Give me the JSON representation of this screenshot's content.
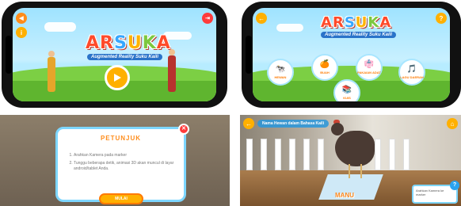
{
  "screen1": {
    "logo": {
      "a": "A",
      "r": "R",
      "s": "S",
      "u": "U",
      "k": "K",
      "a2": "A"
    },
    "tagline": "Augmented Reality Suku Kaili",
    "play_icon": "play-icon",
    "sound_icon": "speaker-icon",
    "info_icon": "info-icon",
    "exit_icon": "exit-icon"
  },
  "screen2": {
    "logo": {
      "a": "A",
      "r": "R",
      "s": "S",
      "u": "U",
      "k": "K",
      "a2": "A"
    },
    "tagline": "Augmented Reality Suku Kaili",
    "back_icon": "back-arrow-icon",
    "help_label": "?",
    "menu": [
      {
        "label": "HEWAN",
        "icon": "animal-icon",
        "glyph": "🐄"
      },
      {
        "label": "BUAH",
        "icon": "fruit-icon",
        "glyph": "🍊"
      },
      {
        "label": "PAKAIAN ADAT",
        "icon": "clothing-icon",
        "glyph": "👘"
      },
      {
        "label": "LAGU DAERAH",
        "icon": "music-icon",
        "glyph": "🎵"
      },
      {
        "label": "KUIS",
        "icon": "quiz-icon",
        "glyph": "📚"
      }
    ]
  },
  "screen3": {
    "title": "PETUNJUK",
    "steps": [
      "Arahkan Kamera pada marker",
      "Tunggu beberapa detik, animasi 3D akan muncul di layar android/tablet Anda."
    ],
    "button": "MULAI",
    "close_label": "✕"
  },
  "screen4": {
    "header": "Nama Hewan dalam Bahasa Kaili",
    "marker_text": "MANU",
    "hint": "Arahkan Kamera ke marker",
    "help_label": "?",
    "back_icon": "back-arrow-icon",
    "home_icon": "home-icon"
  }
}
